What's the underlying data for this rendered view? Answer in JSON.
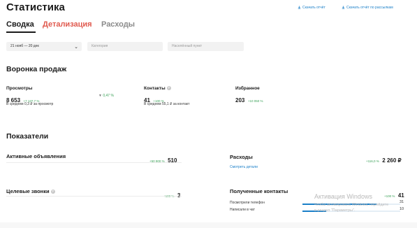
{
  "page": {
    "title": "Статистика"
  },
  "top_links": {
    "download_report": "Скачать отчёт",
    "download_mailing": "Скачать отчёт по рассылкам"
  },
  "tabs": [
    {
      "label": "Сводка",
      "active": true
    },
    {
      "label": "Детализация",
      "active": false
    },
    {
      "label": "Расходы",
      "active": false
    }
  ],
  "filters": {
    "date_range": "21 нояб — 20 дек",
    "category_placeholder": "Категория",
    "location_placeholder": "Населённый пункт"
  },
  "funnel": {
    "title": "Воронка продаж",
    "views": {
      "label": "Просмотры",
      "value": "8 653",
      "delta": "+7 137,7 %",
      "note": "В среднем 0,3 ₽ за просмотр"
    },
    "conversion": {
      "value": "0,47 %"
    },
    "contacts": {
      "label": "Контакты",
      "value": "41",
      "delta": "+100 %",
      "note": "В среднем 55,1 ₽ за контакт"
    },
    "favorites": {
      "label": "Избранное",
      "value": "203",
      "delta": "+10 050 %"
    }
  },
  "metrics": {
    "title": "Показатели",
    "active_ads": {
      "label": "Активные объявления",
      "delta": "+50 900 %",
      "value": "510"
    },
    "expenses": {
      "label": "Расходы",
      "delta": "+116,0 %",
      "value": "2 260 ₽",
      "link": "Смотреть детали"
    },
    "target_calls": {
      "label": "Целевые звонки",
      "delta": "+100 %",
      "value": "3"
    },
    "received_contacts": {
      "label": "Полученные контакты",
      "delta": "+100 %",
      "value": "41",
      "rows": [
        {
          "label": "Посмотрели телефон",
          "value": "31",
          "fraction": 0.76
        },
        {
          "label": "Написали в чат",
          "value": "10",
          "fraction": 0.24
        }
      ]
    }
  },
  "watermark": {
    "line1": "Активация Windows",
    "line2": "Чтобы активировать Windows, перейдите",
    "line3": "в раздел \"Параметры\"."
  },
  "colors": {
    "accent": "#1a7fc8",
    "positive": "#3aa057",
    "tab_red": "#e05a4f",
    "filter_bg": "#f2f2f2"
  },
  "icons": [
    "download-icon",
    "chevron-down-icon",
    "info-icon",
    "conversion-arrow-icon"
  ]
}
